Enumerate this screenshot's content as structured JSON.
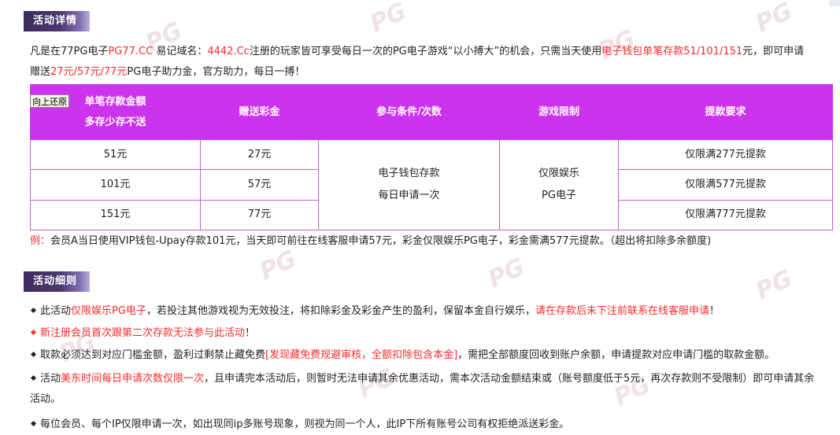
{
  "watermark_text": "PG",
  "section1": {
    "title": "活动详情"
  },
  "intro": {
    "p1": "凡是在77PG电子",
    "p2": "PG77.CC",
    "p3": " 易记域名：",
    "p4": "4442.Cc",
    "p5": "注册的玩家皆可享受每日一次的PG电子游戏“以小搏大”的机会，只需当天使用",
    "p6": "电子钱包单笔存款51/101/151",
    "p7": "元，即可申请",
    "p8": "赠送",
    "p9": "27元/57元/77元",
    "p10": "PG电子助力金，官方助力，每日一搏！"
  },
  "restore_button": "向上还原",
  "table": {
    "headers": [
      "单笔存款金额",
      "多存少存不送",
      "赠送彩金",
      "参与条件/次数",
      "游戏限制",
      "提款要求"
    ],
    "rows": [
      {
        "deposit": "51元",
        "bonus": "27元",
        "withdraw": "仅限满277元提款"
      },
      {
        "deposit": "101元",
        "bonus": "57元",
        "withdraw": "仅限满577元提款"
      },
      {
        "deposit": "151元",
        "bonus": "77元",
        "withdraw": "仅限满777元提款"
      }
    ],
    "condition_line1": "电子钱包存款",
    "condition_line2": "每日申请一次",
    "limit_line1": "仅限娱乐",
    "limit_line2": "PG电子"
  },
  "example": {
    "label": "例：",
    "text": "会员A当日使用VIP钱包-Upay存款101元，当天即可前往在线客服申请57元，彩金仅限娱乐PG电子，彩金需满577元提款。（超出将扣除多余额度)"
  },
  "section2": {
    "title": "活动细则"
  },
  "rules": {
    "r1a": "此活动",
    "r1b": "仅限娱乐PG电子",
    "r1c": "，若投注其他游戏视为无效投注，将扣除彩金及彩金产生的盈利，保留本金自行娱乐，",
    "r1d": "请在存款后未下注前联系在线客服申请",
    "r1e": "！",
    "r2a": "新注册会员首次跟第二次存款无法参与此活动",
    "r2b": "！",
    "r3a": "取款必须达到对应门槛金额，盈利过剩禁止藏免费",
    "r3b": "[发现藏免费规避审核，全额扣除包含本金]",
    "r3c": "，需把全部额度回收到账户余额，申请提款对应申请门槛的取款金额。",
    "r4a": "活动",
    "r4b": "美东时间每日申请次数仅限一次",
    "r4c": "，且申请完本活动后，则暂时无法申请其余优惠活动，需本次活动金额结束或（账号额度低于5元，再次存款则不受限制）即可申请其余",
    "r4d": "活动。",
    "r5": "每位会员、每个IP仅限申请一次，如出现同ip多账号现象，则视为同一个人，此IP下所有账号公司有权拒绝派送彩金。"
  }
}
